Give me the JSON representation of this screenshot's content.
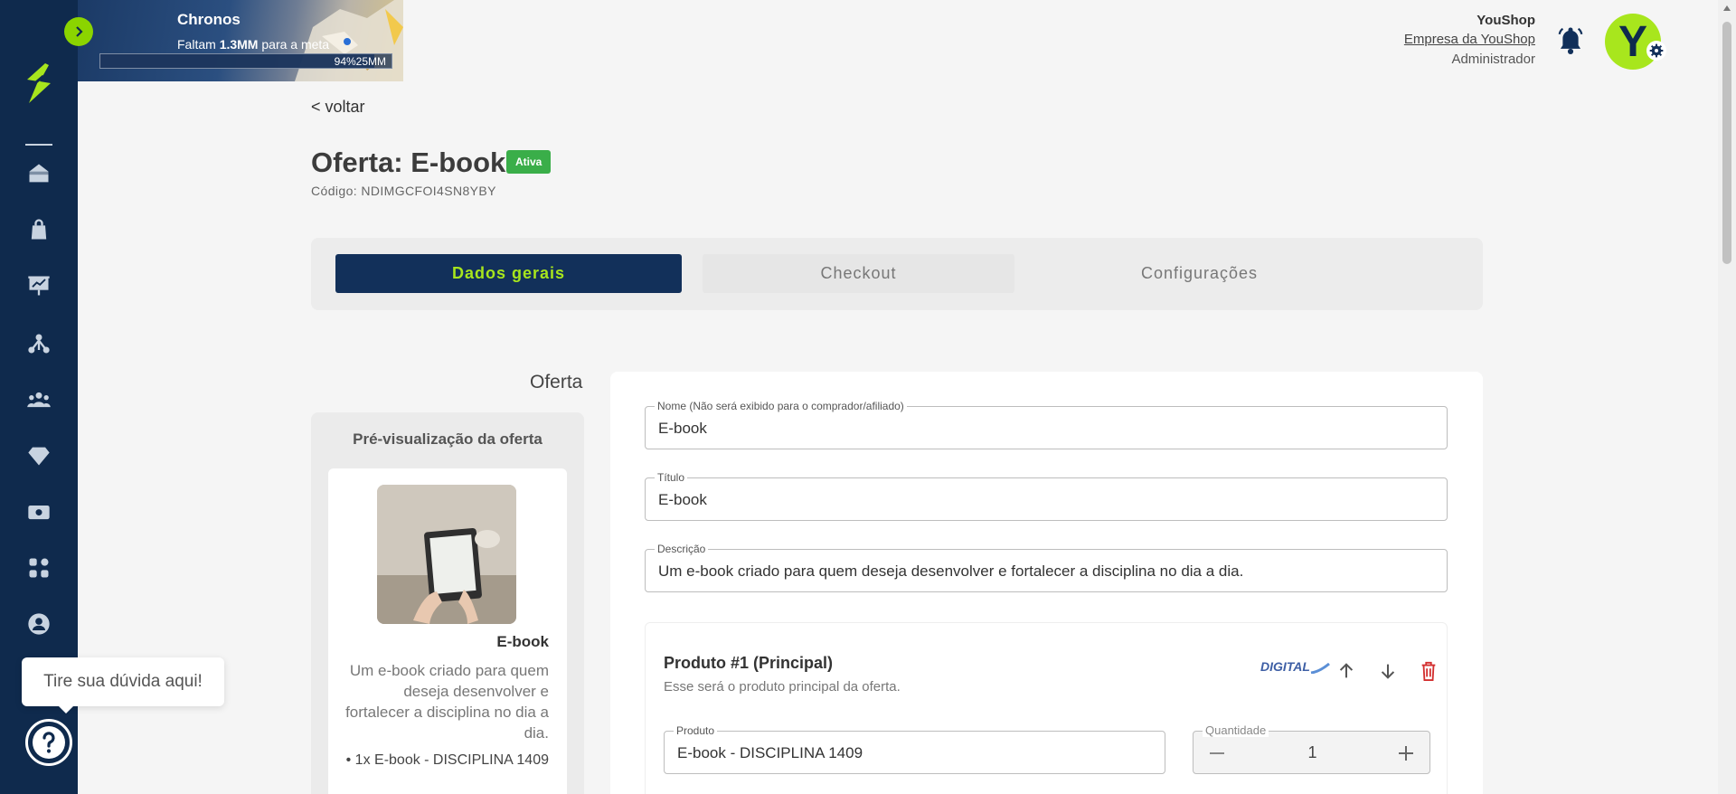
{
  "banner": {
    "title": "Chronos",
    "subtitle_prefix": "Faltam ",
    "subtitle_amount": "1.3MM",
    "subtitle_suffix": " para a meta",
    "progress_text": "94%25MM",
    "progress_fraction": 0.94
  },
  "user": {
    "name": "YouShop",
    "company": "Empresa da YouShop",
    "role": "Administrador",
    "avatar_letter": "Y"
  },
  "sidebar": {
    "items": [
      {
        "icon": "store-icon"
      },
      {
        "icon": "shopping-bag-icon"
      },
      {
        "icon": "presentation-chart-icon"
      },
      {
        "icon": "affiliates-network-icon"
      },
      {
        "icon": "users-group-icon"
      },
      {
        "icon": "diamond-icon"
      },
      {
        "icon": "money-icon"
      },
      {
        "icon": "apps-grid-icon"
      },
      {
        "icon": "user-circle-icon"
      }
    ]
  },
  "page": {
    "back": "< voltar",
    "title": "Oferta: E-book",
    "status": "Ativa",
    "code": "Código: NDIMGCFOI4SN8YBY"
  },
  "tabs": [
    {
      "label": "Dados gerais",
      "active": true
    },
    {
      "label": "Checkout",
      "active": false
    },
    {
      "label": "Configurações",
      "active": false
    }
  ],
  "section": {
    "title": "Oferta"
  },
  "preview": {
    "heading": "Pré-visualização da oferta",
    "name": "E-book",
    "description": "Um e-book criado para quem deseja desenvolver e fortalecer a disciplina no dia a dia.",
    "item": "• 1x E-book - DISCIPLINA 1409"
  },
  "form": {
    "name_label": "Nome (Não será exibido para o comprador/afiliado)",
    "name_value": "E-book",
    "title_label": "Título",
    "title_value": "E-book",
    "description_label": "Descrição",
    "description_value": "Um e-book criado para quem deseja desenvolver e fortalecer a disciplina no dia a dia."
  },
  "product": {
    "title": "Produto #1 (Principal)",
    "subtitle": "Esse será o produto principal da oferta.",
    "type_badge": "DIGITAL",
    "product_label": "Produto",
    "product_value": "E-book - DISCIPLINA 1409",
    "quantity_label": "Quantidade",
    "quantity_value": "1"
  },
  "help": {
    "text": "Tire sua dúvida aqui!"
  },
  "colors": {
    "sidebar": "#0f2a4d",
    "accent": "#a7e51d",
    "active_tab": "#12305a",
    "status_active": "#3aae49",
    "delete": "#d32f2f"
  }
}
